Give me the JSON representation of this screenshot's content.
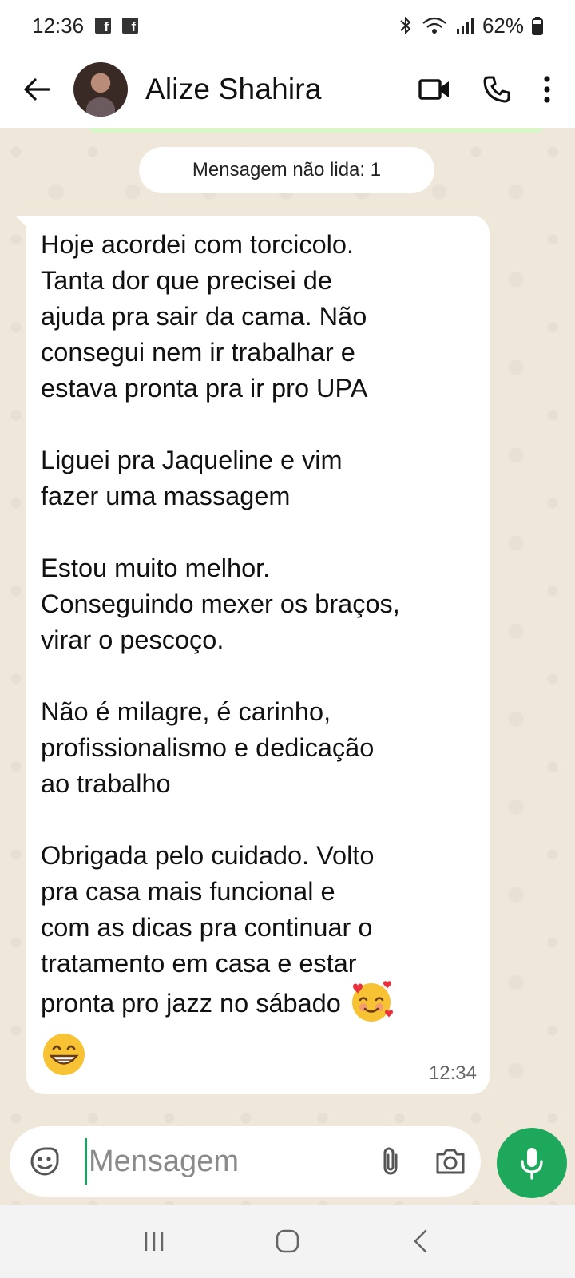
{
  "status_bar": {
    "time": "12:36",
    "notification_icons": [
      "facebook-icon",
      "facebook-icon"
    ],
    "battery": "62%",
    "icons": [
      "bluetooth-icon",
      "wifi-icon",
      "signal-icon",
      "battery-icon"
    ]
  },
  "header": {
    "contact_name": "Alize Shahira",
    "icons": [
      "back-arrow-icon",
      "video-call-icon",
      "phone-call-icon",
      "more-vert-icon"
    ]
  },
  "chat": {
    "unread_label": "Mensagem não lida: 1",
    "message": {
      "paragraphs": [
        "Hoje acordei com torcicolo.\nTanta dor que precisei de\najuda pra sair da cama. Não\nconsegui nem ir trabalhar e\nestava pronta pra ir pro UPA",
        "Liguei pra Jaqueline e vim\nfazer uma massagem",
        "Estou muito melhor.\nConseguindo mexer os braços,\nvirar o pescoço.",
        "Não é milagre, é carinho,\nprofissionalismo e dedicação\nao trabalho",
        "Obrigada pelo cuidado. Volto\npra casa mais funcional e\ncom as dicas pra continuar o\ntratamento em casa e estar"
      ],
      "last_line": "pronta pro jazz no sábado ",
      "emojis": [
        "smiling-face-with-hearts-emoji",
        "grinning-face-emoji"
      ],
      "time": "12:34"
    }
  },
  "composer": {
    "placeholder": "Mensagem",
    "value": "",
    "icons": [
      "sticker-icon",
      "attach-icon",
      "camera-icon",
      "mic-icon"
    ]
  },
  "nav": {
    "icons": [
      "recent-apps-icon",
      "home-icon",
      "back-icon"
    ]
  },
  "colors": {
    "chat_background": "#efe7da",
    "accent_green": "#1ea85b",
    "bubble": "#ffffff"
  }
}
